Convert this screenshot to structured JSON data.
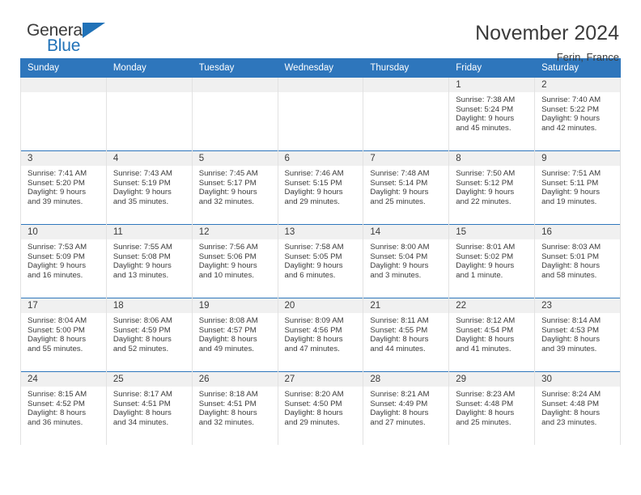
{
  "brand": {
    "name_part1": "General",
    "name_part2": "Blue",
    "colors": {
      "blue": "#2072b8",
      "dark": "#3b3b3b"
    }
  },
  "header": {
    "title": "November 2024",
    "subtitle": "Ferin, France"
  },
  "calendar": {
    "header_bg": "#2e76bc",
    "daynum_bg": "#f0f0f0",
    "weekdays": [
      "Sunday",
      "Monday",
      "Tuesday",
      "Wednesday",
      "Thursday",
      "Friday",
      "Saturday"
    ],
    "weeks": [
      [
        {
          "day": "",
          "lines": []
        },
        {
          "day": "",
          "lines": []
        },
        {
          "day": "",
          "lines": []
        },
        {
          "day": "",
          "lines": []
        },
        {
          "day": "",
          "lines": []
        },
        {
          "day": "1",
          "lines": [
            "Sunrise: 7:38 AM",
            "Sunset: 5:24 PM",
            "Daylight: 9 hours",
            "and 45 minutes."
          ]
        },
        {
          "day": "2",
          "lines": [
            "Sunrise: 7:40 AM",
            "Sunset: 5:22 PM",
            "Daylight: 9 hours",
            "and 42 minutes."
          ]
        }
      ],
      [
        {
          "day": "3",
          "lines": [
            "Sunrise: 7:41 AM",
            "Sunset: 5:20 PM",
            "Daylight: 9 hours",
            "and 39 minutes."
          ]
        },
        {
          "day": "4",
          "lines": [
            "Sunrise: 7:43 AM",
            "Sunset: 5:19 PM",
            "Daylight: 9 hours",
            "and 35 minutes."
          ]
        },
        {
          "day": "5",
          "lines": [
            "Sunrise: 7:45 AM",
            "Sunset: 5:17 PM",
            "Daylight: 9 hours",
            "and 32 minutes."
          ]
        },
        {
          "day": "6",
          "lines": [
            "Sunrise: 7:46 AM",
            "Sunset: 5:15 PM",
            "Daylight: 9 hours",
            "and 29 minutes."
          ]
        },
        {
          "day": "7",
          "lines": [
            "Sunrise: 7:48 AM",
            "Sunset: 5:14 PM",
            "Daylight: 9 hours",
            "and 25 minutes."
          ]
        },
        {
          "day": "8",
          "lines": [
            "Sunrise: 7:50 AM",
            "Sunset: 5:12 PM",
            "Daylight: 9 hours",
            "and 22 minutes."
          ]
        },
        {
          "day": "9",
          "lines": [
            "Sunrise: 7:51 AM",
            "Sunset: 5:11 PM",
            "Daylight: 9 hours",
            "and 19 minutes."
          ]
        }
      ],
      [
        {
          "day": "10",
          "lines": [
            "Sunrise: 7:53 AM",
            "Sunset: 5:09 PM",
            "Daylight: 9 hours",
            "and 16 minutes."
          ]
        },
        {
          "day": "11",
          "lines": [
            "Sunrise: 7:55 AM",
            "Sunset: 5:08 PM",
            "Daylight: 9 hours",
            "and 13 minutes."
          ]
        },
        {
          "day": "12",
          "lines": [
            "Sunrise: 7:56 AM",
            "Sunset: 5:06 PM",
            "Daylight: 9 hours",
            "and 10 minutes."
          ]
        },
        {
          "day": "13",
          "lines": [
            "Sunrise: 7:58 AM",
            "Sunset: 5:05 PM",
            "Daylight: 9 hours",
            "and 6 minutes."
          ]
        },
        {
          "day": "14",
          "lines": [
            "Sunrise: 8:00 AM",
            "Sunset: 5:04 PM",
            "Daylight: 9 hours",
            "and 3 minutes."
          ]
        },
        {
          "day": "15",
          "lines": [
            "Sunrise: 8:01 AM",
            "Sunset: 5:02 PM",
            "Daylight: 9 hours",
            "and 1 minute."
          ]
        },
        {
          "day": "16",
          "lines": [
            "Sunrise: 8:03 AM",
            "Sunset: 5:01 PM",
            "Daylight: 8 hours",
            "and 58 minutes."
          ]
        }
      ],
      [
        {
          "day": "17",
          "lines": [
            "Sunrise: 8:04 AM",
            "Sunset: 5:00 PM",
            "Daylight: 8 hours",
            "and 55 minutes."
          ]
        },
        {
          "day": "18",
          "lines": [
            "Sunrise: 8:06 AM",
            "Sunset: 4:59 PM",
            "Daylight: 8 hours",
            "and 52 minutes."
          ]
        },
        {
          "day": "19",
          "lines": [
            "Sunrise: 8:08 AM",
            "Sunset: 4:57 PM",
            "Daylight: 8 hours",
            "and 49 minutes."
          ]
        },
        {
          "day": "20",
          "lines": [
            "Sunrise: 8:09 AM",
            "Sunset: 4:56 PM",
            "Daylight: 8 hours",
            "and 47 minutes."
          ]
        },
        {
          "day": "21",
          "lines": [
            "Sunrise: 8:11 AM",
            "Sunset: 4:55 PM",
            "Daylight: 8 hours",
            "and 44 minutes."
          ]
        },
        {
          "day": "22",
          "lines": [
            "Sunrise: 8:12 AM",
            "Sunset: 4:54 PM",
            "Daylight: 8 hours",
            "and 41 minutes."
          ]
        },
        {
          "day": "23",
          "lines": [
            "Sunrise: 8:14 AM",
            "Sunset: 4:53 PM",
            "Daylight: 8 hours",
            "and 39 minutes."
          ]
        }
      ],
      [
        {
          "day": "24",
          "lines": [
            "Sunrise: 8:15 AM",
            "Sunset: 4:52 PM",
            "Daylight: 8 hours",
            "and 36 minutes."
          ]
        },
        {
          "day": "25",
          "lines": [
            "Sunrise: 8:17 AM",
            "Sunset: 4:51 PM",
            "Daylight: 8 hours",
            "and 34 minutes."
          ]
        },
        {
          "day": "26",
          "lines": [
            "Sunrise: 8:18 AM",
            "Sunset: 4:51 PM",
            "Daylight: 8 hours",
            "and 32 minutes."
          ]
        },
        {
          "day": "27",
          "lines": [
            "Sunrise: 8:20 AM",
            "Sunset: 4:50 PM",
            "Daylight: 8 hours",
            "and 29 minutes."
          ]
        },
        {
          "day": "28",
          "lines": [
            "Sunrise: 8:21 AM",
            "Sunset: 4:49 PM",
            "Daylight: 8 hours",
            "and 27 minutes."
          ]
        },
        {
          "day": "29",
          "lines": [
            "Sunrise: 8:23 AM",
            "Sunset: 4:48 PM",
            "Daylight: 8 hours",
            "and 25 minutes."
          ]
        },
        {
          "day": "30",
          "lines": [
            "Sunrise: 8:24 AM",
            "Sunset: 4:48 PM",
            "Daylight: 8 hours",
            "and 23 minutes."
          ]
        }
      ]
    ]
  }
}
